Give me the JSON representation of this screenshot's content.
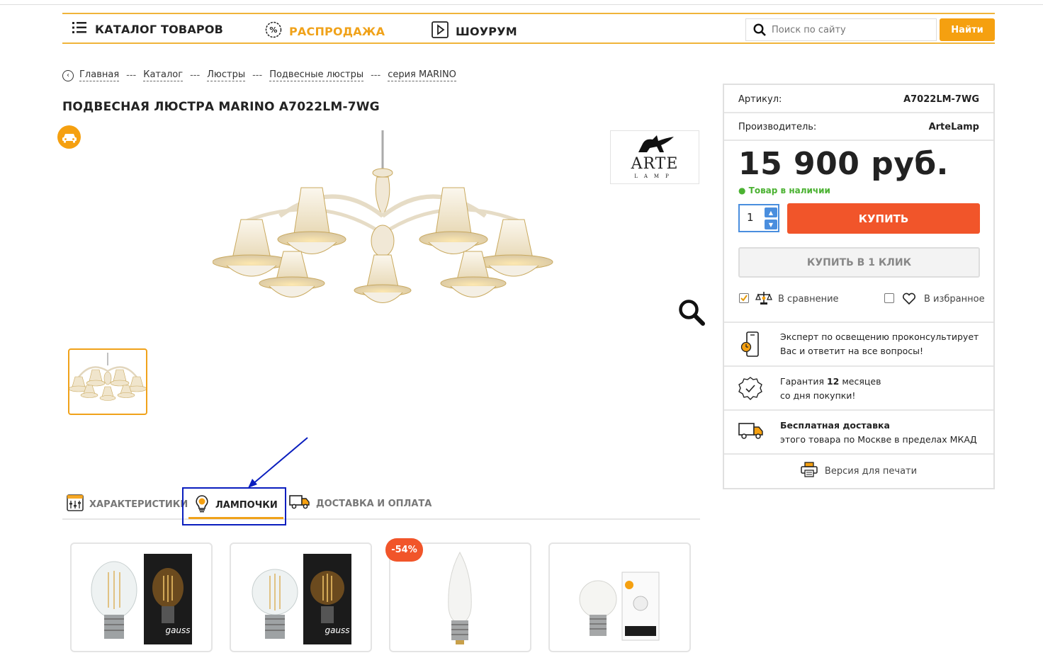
{
  "nav": {
    "catalog": "КАТАЛОГ ТОВАРОВ",
    "sale": "РАСПРОДАЖА",
    "showroom": "ШОУРУМ",
    "search_placeholder": "Поиск по сайту",
    "search_button": "Найти"
  },
  "breadcrumbs": [
    "Главная",
    "Каталог",
    "Люстры",
    "Подвесные люстры",
    "серия MARINO"
  ],
  "breadcrumb_sep": "---",
  "product": {
    "title": "ПОДВЕСНАЯ ЛЮСТРА MARINO A7022LM-7WG",
    "brand_logo_text": "ARTE",
    "brand_logo_sub": "LAMP"
  },
  "tabs": [
    "ХАРАКТЕРИСТИКИ",
    "ЛАМПОЧКИ",
    "ДОСТАВКА И ОПЛАТА"
  ],
  "active_tab": "ЛАМПОЧКИ",
  "cards": {
    "discount_badge": "-54%"
  },
  "panel": {
    "article_label": "Артикул:",
    "article_value": "A7022LM-7WG",
    "maker_label": "Производитель:",
    "maker_value": "ArteLamp",
    "price": "15 900 руб.",
    "stock": "Товар в наличии",
    "qty": "1",
    "buy": "КУПИТЬ",
    "one_click": "КУПИТЬ В 1 КЛИК",
    "compare": "В сравнение",
    "favorite": "В избранное",
    "expert_line1": "Эксперт по освещению проконсультирует",
    "expert_line2": "Вас и ответит на все вопросы!",
    "warranty_pre": "Гарантия",
    "warranty_num": "12",
    "warranty_post": "месяцев",
    "warranty_line2": "со дня покупки!",
    "delivery_bold": "Бесплатная доставка",
    "delivery_line2": "этого товара по Москве в пределах МКАД",
    "print": "Версия для печати"
  },
  "colors": {
    "accent": "#f5a010",
    "buy": "#f1552a",
    "stock": "#4bb232",
    "annotation": "#0a1ebe"
  }
}
